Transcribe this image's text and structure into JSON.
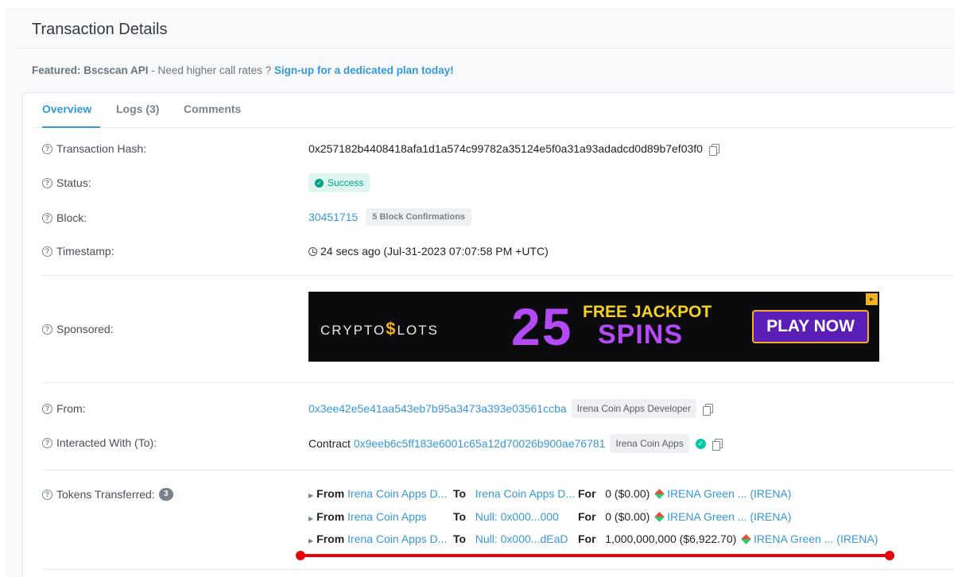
{
  "page": {
    "title": "Transaction Details",
    "featured_bold": "Featured: Bscscan API",
    "featured_text": " - Need higher call rates ? ",
    "featured_link": "Sign-up for a dedicated plan today!"
  },
  "tabs": [
    {
      "label": "Overview",
      "active": true
    },
    {
      "label": "Logs (3)",
      "active": false
    },
    {
      "label": "Comments",
      "active": false
    }
  ],
  "labels": {
    "tx_hash": "Transaction Hash:",
    "status": "Status:",
    "block": "Block:",
    "timestamp": "Timestamp:",
    "sponsored": "Sponsored:",
    "from": "From:",
    "interacted": "Interacted With (To):",
    "tokens": "Tokens Transferred:"
  },
  "values": {
    "tx_hash": "0x257182b4408418afa1d1a574c99782a35124e5f0a31a93adadcd0d89b7ef03f0",
    "status": "Success",
    "block_number": "30451715",
    "block_confirmations": "5 Block Confirmations",
    "timestamp": "24 secs ago (Jul-31-2023 07:07:58 PM +UTC)",
    "from_address": "0x3ee42e5e41aa543eb7b95a3473a393e03561ccba",
    "from_tag": "Irena Coin Apps Developer",
    "contract_prefix": "Contract",
    "contract_address": "0x9eeb6c5ff183e6001c65a12d70026b900ae76781",
    "contract_tag": "Irena Coin Apps",
    "tokens_count": "3"
  },
  "ad": {
    "logo_left": "CRYPTO",
    "logo_dollar": "$",
    "logo_right": "LOTS",
    "big_number": "25",
    "free_text": "FREE JACKPOT",
    "spins_text": "SPINS",
    "button": "PLAY NOW"
  },
  "transfers": [
    {
      "from_kw": "From",
      "from": "Irena Coin Apps D...",
      "to_kw": "To",
      "to": "Irena Coin Apps D...",
      "for_kw": "For",
      "amount": "0 ($0.00)",
      "token": "IRENA Green ... (IRENA)"
    },
    {
      "from_kw": "From",
      "from": "Irena Coin Apps",
      "to_kw": "To",
      "to": "Null: 0x000...000",
      "for_kw": "For",
      "amount": "0 ($0.00)",
      "token": "IRENA Green ... (IRENA)"
    },
    {
      "from_kw": "From",
      "from": "Irena Coin Apps D...",
      "to_kw": "To",
      "to": "Null: 0x000...dEaD",
      "for_kw": "For",
      "amount": "1,000,000,000 ($6,922.70)",
      "token": "IRENA Green ... (IRENA)"
    }
  ],
  "colors": {
    "accent": "#3498db",
    "success": "#00a186",
    "highlight_annotation": "#e8000c"
  }
}
